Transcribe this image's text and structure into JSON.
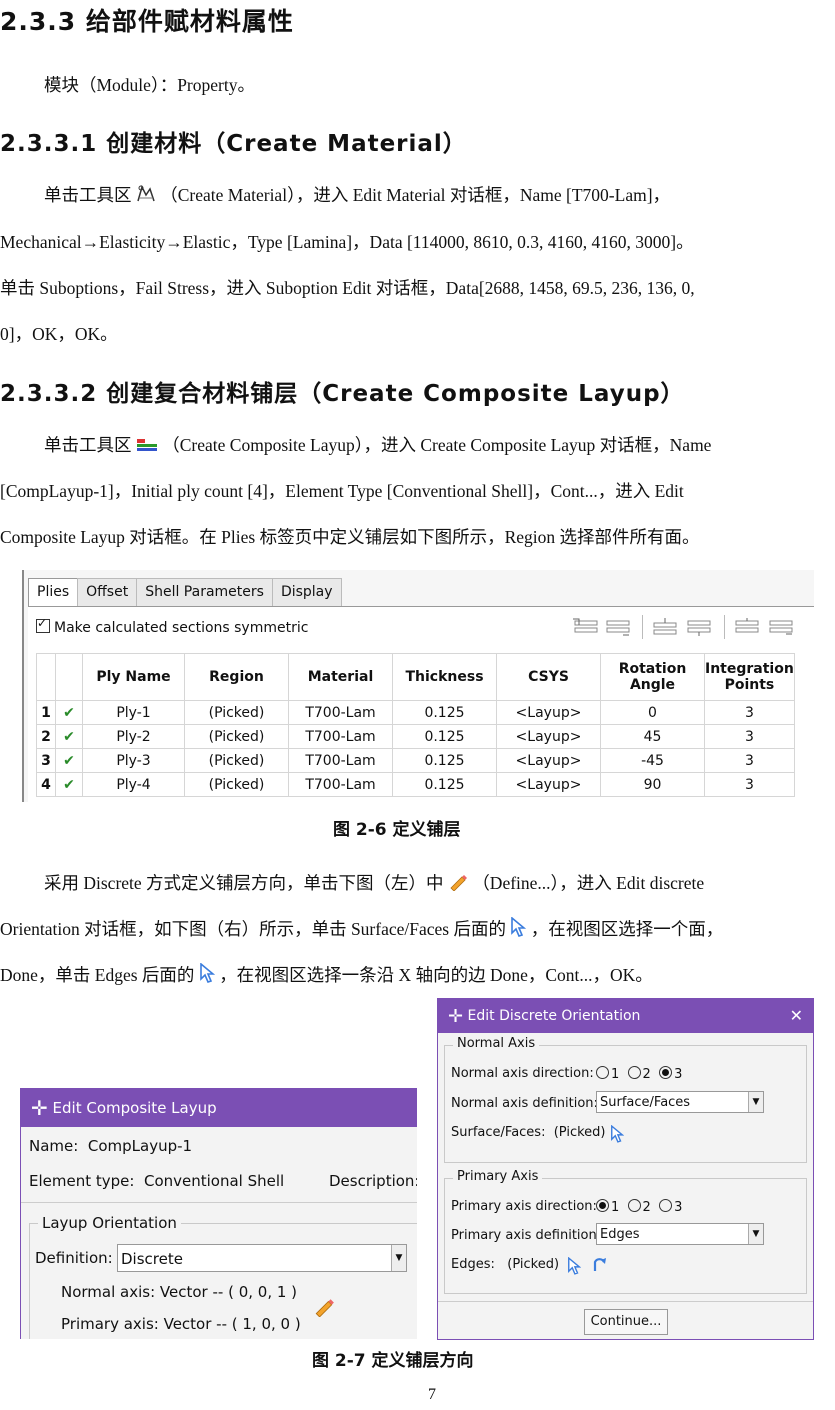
{
  "section_233": {
    "title": "2.3.3 给部件赋材料属性",
    "module_line": "模块（Module）：Property。"
  },
  "section_2331": {
    "title": "2.3.3.1 创建材料（Create Material）",
    "line1_a": "单击工具区",
    "line1_b": "（Create Material），进入 Edit Material 对话框，Name [T700-Lam]，",
    "line2": "Mechanical→Elasticity→Elastic，Type [Lamina]，Data [114000, 8610, 0.3, 4160, 4160, 3000]。",
    "line3": "单击 Suboptions，Fail Stress，进入 Suboption Edit 对话框，Data[2688, 1458, 69.5, 236, 136, 0,",
    "line4": "0]，OK，OK。"
  },
  "section_2332": {
    "title": "2.3.3.2 创建复合材料铺层（Create Composite Layup）",
    "line1_a": "单击工具区",
    "line1_b": "（Create Composite Layup），进入 Create Composite Layup 对话框，Name",
    "line2": "[CompLayup-1]，Initial ply count [4]，Element Type [Conventional Shell]，Cont...，进入 Edit",
    "line3": "Composite Layup 对话框。在 Plies 标签页中定义铺层如下图所示，Region 选择部件所有面。"
  },
  "plies_panel": {
    "tabs": [
      "Plies",
      "Offset",
      "Shell Parameters",
      "Display"
    ],
    "checkbox_label": "Make calculated sections symmetric",
    "headers": [
      "Ply Name",
      "Region",
      "Material",
      "Thickness",
      "CSYS",
      "Rotation Angle",
      "Integration Points"
    ],
    "rows": [
      {
        "num": "1",
        "name": "Ply-1",
        "region": "(Picked)",
        "material": "T700-Lam",
        "thickness": "0.125",
        "csys": "<Layup>",
        "angle": "0",
        "points": "3"
      },
      {
        "num": "2",
        "name": "Ply-2",
        "region": "(Picked)",
        "material": "T700-Lam",
        "thickness": "0.125",
        "csys": "<Layup>",
        "angle": "45",
        "points": "3"
      },
      {
        "num": "3",
        "name": "Ply-3",
        "region": "(Picked)",
        "material": "T700-Lam",
        "thickness": "0.125",
        "csys": "<Layup>",
        "angle": "-45",
        "points": "3"
      },
      {
        "num": "4",
        "name": "Ply-4",
        "region": "(Picked)",
        "material": "T700-Lam",
        "thickness": "0.125",
        "csys": "<Layup>",
        "angle": "90",
        "points": "3"
      }
    ],
    "check_glyph": "✔"
  },
  "caption_26": "图 2-6    定义铺层",
  "orientation_text": {
    "line1_a": "采用 Discrete 方式定义铺层方向，单击下图（左）中",
    "line1_b": "（Define...），进入 Edit discrete",
    "line2_a": "Orientation 对话框，如下图（右）所示，单击 Surface/Faces 后面的",
    "line2_b": "，在视图区选择一个面，",
    "line3_a": "Done，单击 Edges 后面的",
    "line3_b": "，在视图区选择一条沿 X 轴向的边 Done，Cont...，OK。"
  },
  "layup_dialog": {
    "title": "Edit Composite Layup",
    "name_label": "Name:",
    "name_value": "CompLayup-1",
    "etype_label": "Element type:",
    "etype_value": "Conventional Shell",
    "description_label": "Description:",
    "group_title": "Layup Orientation",
    "definition_label": "Definition:",
    "definition_value": "Discrete",
    "normal_axis": "Normal axis: Vector -- ( 0, 0, 1 )",
    "primary_axis": "Primary axis: Vector -- ( 1, 0, 0 )"
  },
  "orient_dialog": {
    "title": "Edit Discrete Orientation",
    "normal_group": "Normal Axis",
    "normal_dir_label": "Normal axis direction:",
    "dir_options": [
      "1",
      "2",
      "3"
    ],
    "normal_def_label": "Normal axis definition:",
    "normal_def_value": "Surface/Faces",
    "surface_label": "Surface/Faces:",
    "surface_value": "(Picked)",
    "primary_group": "Primary Axis",
    "primary_dir_label": "Primary axis direction:",
    "primary_def_label": "Primary axis definition:",
    "primary_def_value": "Edges",
    "edges_label": "Edges:",
    "edges_value": "(Picked)",
    "continue_button": "Continue..."
  },
  "caption_27": "图 2-7    定义铺层方向",
  "page_number": "7",
  "colors": {
    "dialog_title": "#7b4fb4",
    "check_green": "#2a8b2a",
    "cursor_blue": "#3b7ddd"
  }
}
